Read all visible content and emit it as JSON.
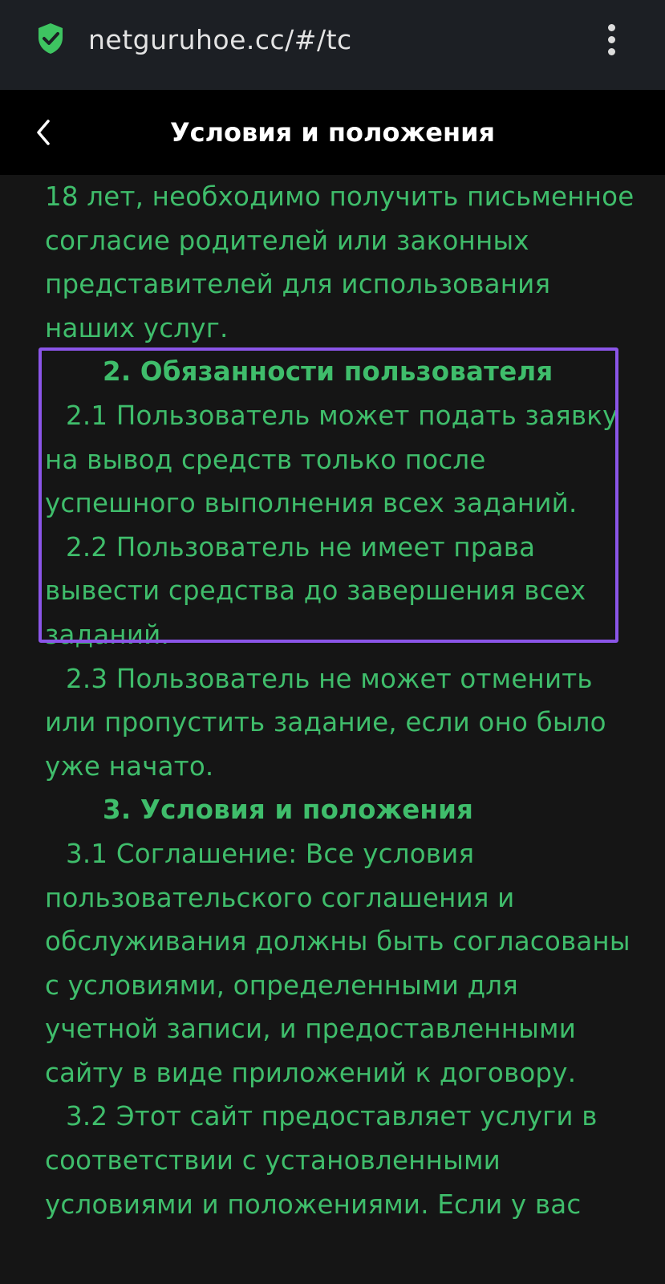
{
  "browser": {
    "url": "netguruhoe.cc/#/tc",
    "secure_icon": "shield-check-icon",
    "menu_icon": "more-vert-icon"
  },
  "header": {
    "back_icon": "chevron-left-icon",
    "title": "Условия и положения"
  },
  "content": {
    "intro": "18 лет, необходимо получить письменное согласие родителей или законных представителей для использования наших услуг.",
    "section2": {
      "heading": "2. Обязанности пользователя",
      "p1": "2.1 Пользователь может подать заявку на вывод средств только после успешного выполнения всех заданий.",
      "p2": "2.2 Пользователь не имеет права вывести средства до завершения всех заданий.",
      "p3": "2.3 Пользователь не может отменить или пропустить задание, если оно было уже начато."
    },
    "section3": {
      "heading": "3. Условия и положения",
      "p1": "3.1 Соглашение: Все условия пользовательского соглашения и обслуживания должны быть согласованы с условиями, определенными для учетной записи, и предоставленными сайту в виде приложений к договору.",
      "p2": "3.2 Этот сайт предоставляет услуги в соответствии с установленными условиями и положениями. Если у вас"
    }
  },
  "colors": {
    "text_green": "#3fbd6b",
    "highlight_border": "#8b55e8",
    "background": "#151515"
  }
}
